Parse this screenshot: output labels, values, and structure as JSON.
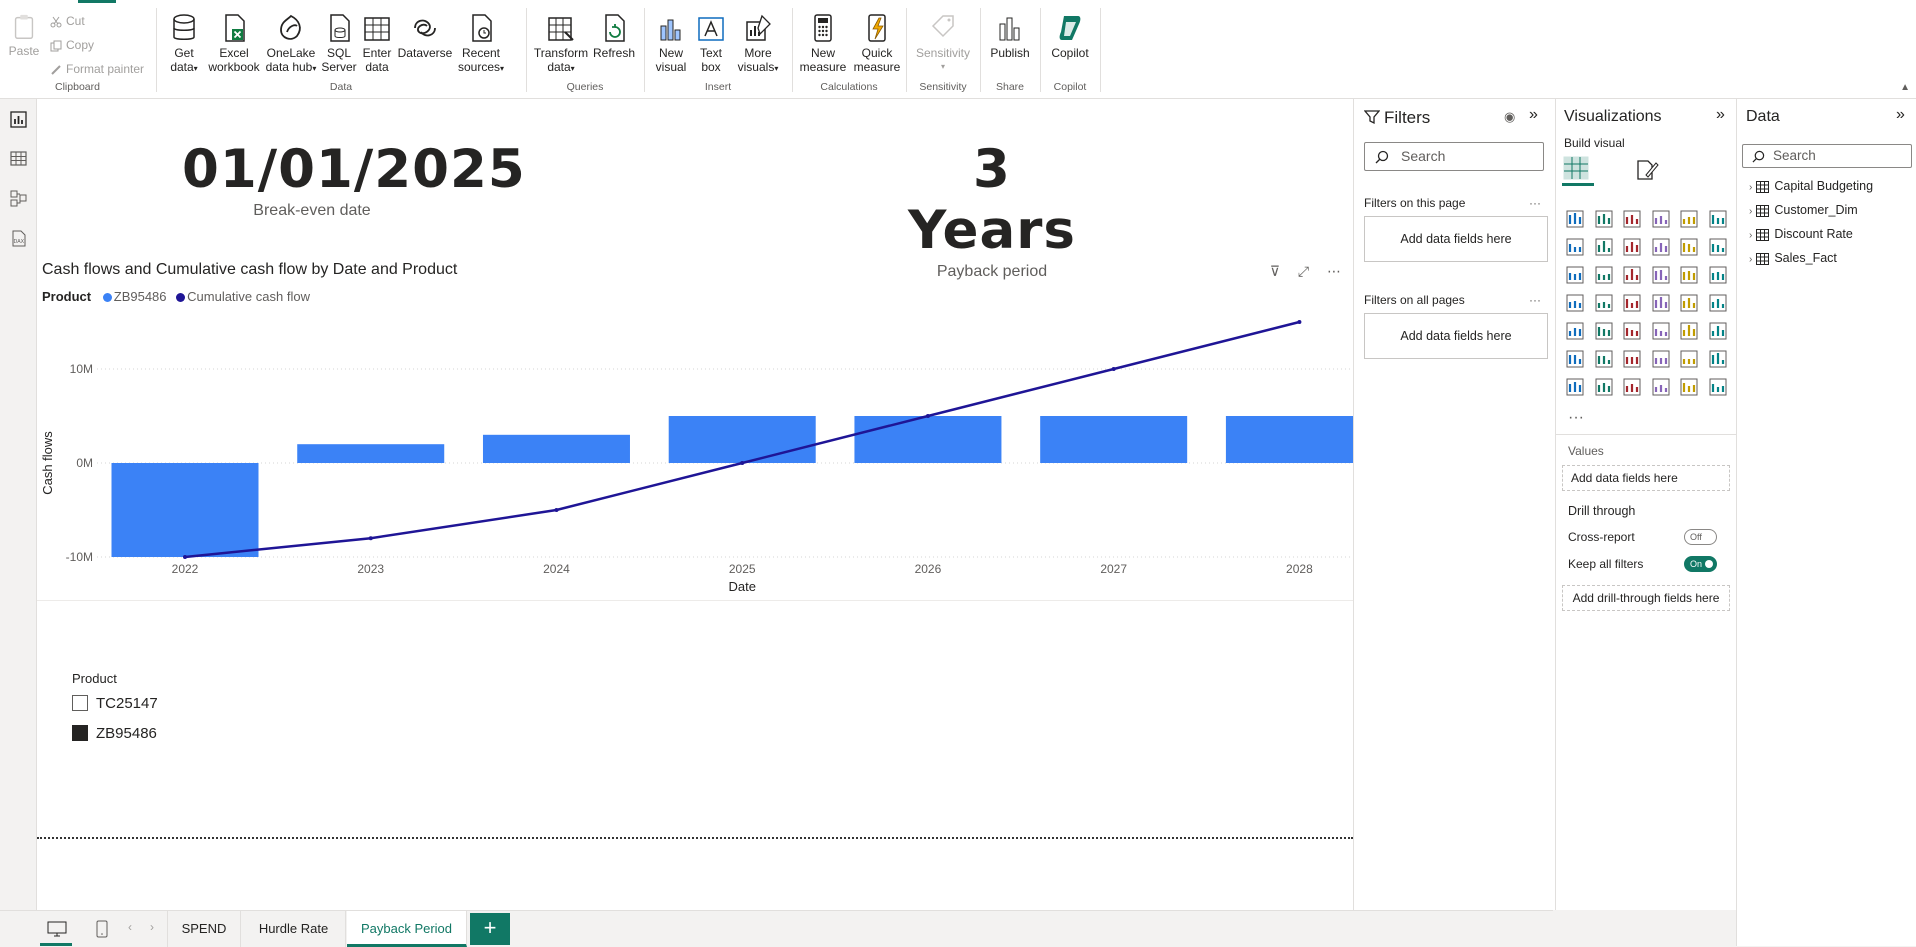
{
  "ribbon": {
    "clipboard": {
      "paste": "Paste",
      "cut": "Cut",
      "copy": "Copy",
      "format_painter": "Format painter",
      "label": "Clipboard"
    },
    "data_group": {
      "label": "Data",
      "get_data": [
        "Get",
        "data"
      ],
      "excel": [
        "Excel",
        "workbook"
      ],
      "onelake": [
        "OneLake",
        "data hub"
      ],
      "sql": [
        "SQL",
        "Server"
      ],
      "enter": [
        "Enter",
        "data"
      ],
      "dataverse": [
        "Dataverse",
        ""
      ],
      "recent": [
        "Recent",
        "sources"
      ]
    },
    "queries": {
      "label": "Queries",
      "transform": [
        "Transform",
        "data"
      ],
      "refresh": [
        "Refresh",
        ""
      ]
    },
    "insert": {
      "label": "Insert",
      "new_visual": [
        "New",
        "visual"
      ],
      "text_box": [
        "Text",
        "box"
      ],
      "more_visuals": [
        "More",
        "visuals"
      ]
    },
    "calculations": {
      "label": "Calculations",
      "new_measure": [
        "New",
        "measure"
      ],
      "quick_measure": [
        "Quick",
        "measure"
      ]
    },
    "sensitivity": {
      "label": "Sensitivity",
      "btn": [
        "Sensitivity",
        ""
      ]
    },
    "share": {
      "label": "Share",
      "publish": [
        "Publish",
        ""
      ]
    },
    "copilot": {
      "label": "Copilot",
      "btn": [
        "Copilot",
        ""
      ]
    }
  },
  "cards": {
    "breakeven": {
      "value": "01/01/2025",
      "caption": "Break-even date"
    },
    "payback": {
      "value": "3 Years",
      "caption": "Payback period"
    }
  },
  "chart": {
    "title": "Cash flows and Cumulative cash flow by Date and Product",
    "legend_title": "Product",
    "colors": {
      "bars": "#3b82f6",
      "line": "#1f1596"
    }
  },
  "chart_data": {
    "type": "bar",
    "title": "Cash flows and Cumulative cash flow by Date and Product",
    "xlabel": "Date",
    "ylabel": "Cash flows",
    "categories": [
      "2022",
      "2023",
      "2024",
      "2025",
      "2026",
      "2027",
      "2028"
    ],
    "ylim": [
      -10,
      15
    ],
    "y_ticks": [
      "-10M",
      "0M",
      "10M"
    ],
    "series": [
      {
        "name": "ZB95486",
        "type": "bar",
        "values": [
          -10,
          2,
          3,
          5,
          5,
          5,
          5
        ]
      },
      {
        "name": "Cumulative cash flow",
        "type": "line",
        "values": [
          -10,
          -8,
          -5,
          0,
          5,
          10,
          15
        ]
      }
    ],
    "legend": "top-left",
    "grid": true
  },
  "slicer": {
    "title": "Product",
    "options": [
      {
        "label": "TC25147",
        "checked": false
      },
      {
        "label": "ZB95486",
        "checked": true
      }
    ]
  },
  "filters_pane": {
    "title": "Filters",
    "search_placeholder": "Search",
    "on_this_page": "Filters on this page",
    "on_all_pages": "Filters on all pages",
    "add_fields": "Add data fields here",
    "more": "···"
  },
  "viz_pane": {
    "title": "Visualizations",
    "build_visual": "Build visual",
    "more": "···",
    "values": "Values",
    "add_fields": "Add data fields here",
    "drill_through": "Drill through",
    "cross_report": "Cross-report",
    "cross_report_state": "Off",
    "keep_all_filters": "Keep all filters",
    "keep_all_filters_state": "On",
    "add_drill": "Add drill-through fields here"
  },
  "data_pane": {
    "title": "Data",
    "search_placeholder": "Search",
    "tables": [
      "Capital Budgeting",
      "Customer_Dim",
      "Discount Rate",
      "Sales_Fact"
    ]
  },
  "pages": {
    "tabs": [
      "SPEND",
      "Hurdle Rate",
      "Payback Period"
    ],
    "active": "Payback Period",
    "add": "+"
  }
}
